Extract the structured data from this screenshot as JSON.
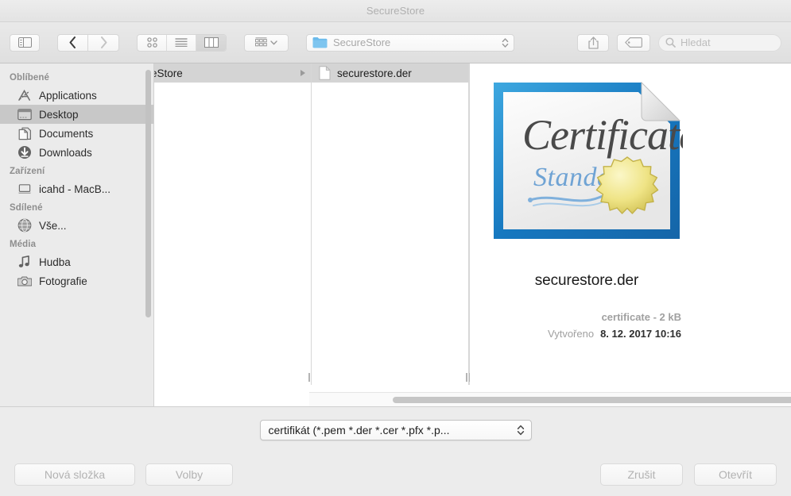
{
  "window": {
    "title": "SecureStore"
  },
  "toolbar": {
    "sidebar_toggle_icon": "sidebar-toggle-icon",
    "back_icon": "chevron-left-icon",
    "forward_icon": "chevron-right-icon",
    "view_icon_grid": "icon-view-icon",
    "view_list": "list-view-icon",
    "view_column": "column-view-icon",
    "arrange_icon": "arrange-by-icon",
    "arrange_chevron": "chevron-down-icon",
    "path_label": "SecureStore",
    "path_chevrons": "up-down-chevron-icon",
    "share_icon": "share-icon",
    "tag_icon": "tag-icon",
    "search_icon": "search-icon",
    "search_placeholder": "Hledat",
    "search_value": ""
  },
  "sidebar": {
    "sections": [
      {
        "header": "Oblíbené",
        "items": [
          {
            "label": "Applications",
            "icon": "applications-icon",
            "selected": false
          },
          {
            "label": "Desktop",
            "icon": "desktop-icon",
            "selected": true
          },
          {
            "label": "Documents",
            "icon": "documents-icon",
            "selected": false
          },
          {
            "label": "Downloads",
            "icon": "downloads-icon",
            "selected": false
          }
        ]
      },
      {
        "header": "Zařízení",
        "items": [
          {
            "label": "icahd - MacB...",
            "icon": "laptop-icon",
            "selected": false
          }
        ]
      },
      {
        "header": "Sdílené",
        "items": [
          {
            "label": "Vše...",
            "icon": "network-globe-icon",
            "selected": false
          }
        ]
      },
      {
        "header": "Média",
        "items": [
          {
            "label": "Hudba",
            "icon": "music-note-icon",
            "selected": false
          },
          {
            "label": "Fotografie",
            "icon": "camera-icon",
            "selected": false
          }
        ]
      }
    ]
  },
  "columns": [
    {
      "rows": [
        {
          "label": "eStore",
          "icon": "folder-icon",
          "selected": true,
          "has_children": true
        }
      ]
    },
    {
      "rows": [
        {
          "label": "securestore.der",
          "icon": "file-icon",
          "selected": true,
          "has_children": false
        }
      ]
    }
  ],
  "preview": {
    "icon_name": "certificate-icon",
    "icon_text_main": "Certificate",
    "icon_text_sub": "Standard",
    "filename": "securestore.der",
    "kind_and_size": "certificate - 2 kB",
    "created_label": "Vytvořeno",
    "created_value": "8. 12. 2017 10:16"
  },
  "filter": {
    "label": "certifikát (*.pem *.der *.cer *.pfx *.p...",
    "chevrons": "up-down-chevron-icon"
  },
  "footer": {
    "new_folder_label": "Nová složka",
    "options_label": "Volby",
    "cancel_label": "Zrušit",
    "open_label": "Otevřít"
  },
  "colors": {
    "accent_folder": "#6bbbec",
    "selected_row": "#d4d4d4",
    "sidebar_selected": "#c8c8c8",
    "cert_border": "#1b7fc4"
  }
}
